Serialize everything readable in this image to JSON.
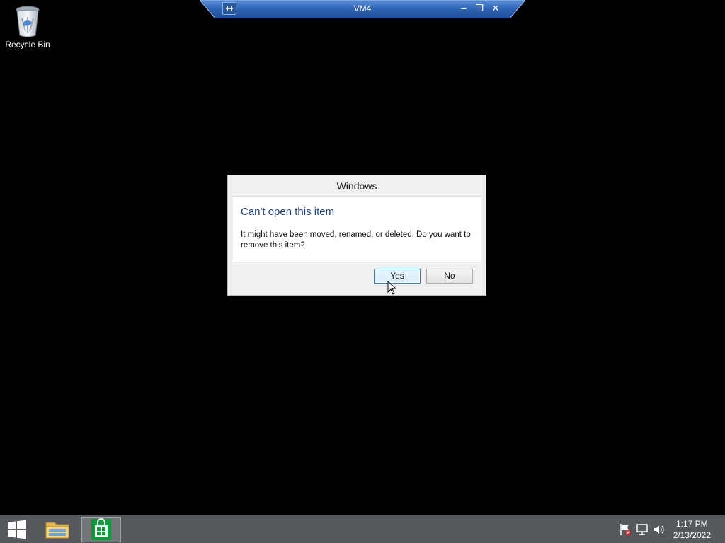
{
  "desktop": {
    "icons": [
      {
        "label": "Recycle Bin",
        "icon": "recycle-bin-icon"
      }
    ]
  },
  "connection_bar": {
    "title": "VM4",
    "controls": [
      "pin-icon",
      "minimize-icon",
      "restore-icon",
      "close-icon"
    ],
    "minimize_glyph": "–",
    "restore_glyph": "❐",
    "close_glyph": "✕"
  },
  "dialog": {
    "title": "Windows",
    "heading": "Can't open this item",
    "message": "It might have been moved, renamed, or deleted. Do you want to remove this item?",
    "buttons": {
      "yes": "Yes",
      "no": "No"
    },
    "colors": {
      "heading": "#1e3f8a"
    }
  },
  "taskbar": {
    "pinned": [
      "windows-start-icon",
      "file-explorer-icon",
      "store-icon"
    ],
    "tray_icons": [
      "action-center-flag-icon",
      "network-icon",
      "volume-icon"
    ],
    "clock": {
      "time": "1:17 PM",
      "date": "2/13/2022"
    },
    "colors": {
      "background": "#55585c",
      "store_accent": "#0e9a3a"
    }
  }
}
